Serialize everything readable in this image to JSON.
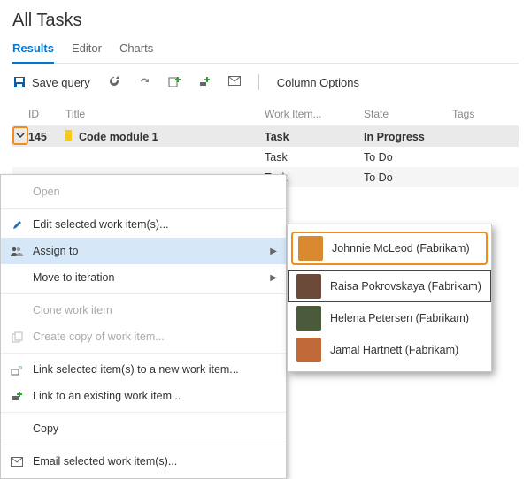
{
  "header": {
    "title": "All Tasks"
  },
  "tabs": {
    "results": "Results",
    "editor": "Editor",
    "charts": "Charts"
  },
  "toolbar": {
    "save_query": "Save query",
    "column_options": "Column Options"
  },
  "columns": {
    "id": "ID",
    "title": "Title",
    "type": "Work Item...",
    "state": "State",
    "tags": "Tags"
  },
  "rows": [
    {
      "id": "145",
      "title": "Code module 1",
      "type": "Task",
      "state": "In Progress"
    },
    {
      "id": "",
      "title": "",
      "type": "Task",
      "state": "To Do"
    },
    {
      "id": "",
      "title": "",
      "type": "Task",
      "state": "To Do"
    }
  ],
  "menu": {
    "open": "Open",
    "edit": "Edit selected work item(s)...",
    "assign": "Assign to",
    "move_iter": "Move to iteration",
    "clone": "Clone work item",
    "copy_of": "Create copy of work item...",
    "link_new": "Link selected item(s) to a new work item...",
    "link_existing": "Link to an existing work item...",
    "copy": "Copy",
    "email": "Email selected work item(s)..."
  },
  "people": [
    {
      "name": "Johnnie McLeod  (Fabrikam)",
      "color": "#d98a2e"
    },
    {
      "name": "Raisa Pokrovskaya (Fabrikam)",
      "color": "#6b4a3a"
    },
    {
      "name": "Helena Petersen (Fabrikam)",
      "color": "#4a5a3a"
    },
    {
      "name": "Jamal Hartnett (Fabrikam)",
      "color": "#c06a3a"
    }
  ]
}
